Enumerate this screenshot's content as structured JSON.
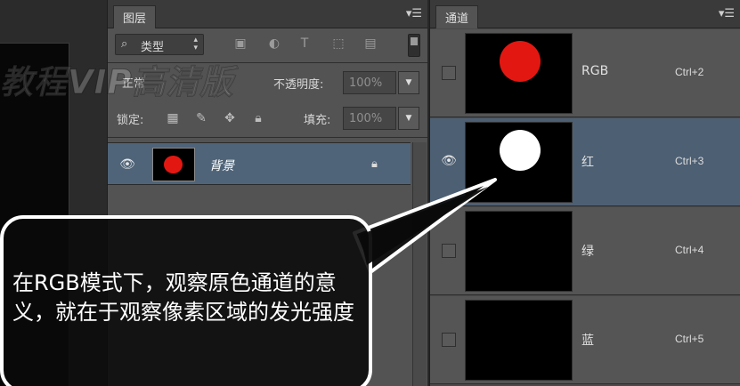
{
  "watermark": "教程VIP高清版",
  "layers_panel": {
    "tab_label": "图层",
    "menu_icon": "panel-menu-icon",
    "kind_filter": "类型",
    "blend_mode": "正常",
    "opacity_label": "不透明度:",
    "opacity_value": "100%",
    "lock_label": "锁定:",
    "fill_label": "填充:",
    "fill_value": "100%",
    "layer": {
      "name": "背景",
      "locked": true,
      "thumb_color": "#e31711"
    }
  },
  "channels_panel": {
    "tab_label": "通道",
    "menu_icon": "panel-menu-icon",
    "channels": [
      {
        "name": "RGB",
        "shortcut": "Ctrl+2",
        "visible": false,
        "selected": false,
        "circle_color": "#e31711"
      },
      {
        "name": "红",
        "shortcut": "Ctrl+3",
        "visible": true,
        "selected": true,
        "circle_color": "#ffffff"
      },
      {
        "name": "绿",
        "shortcut": "Ctrl+4",
        "visible": false,
        "selected": false,
        "circle_color": ""
      },
      {
        "name": "蓝",
        "shortcut": "Ctrl+5",
        "visible": false,
        "selected": false,
        "circle_color": ""
      }
    ]
  },
  "callout": {
    "text": "在RGB模式下，观察原色通道的意义，就在于观察像素区域的发光强度"
  }
}
